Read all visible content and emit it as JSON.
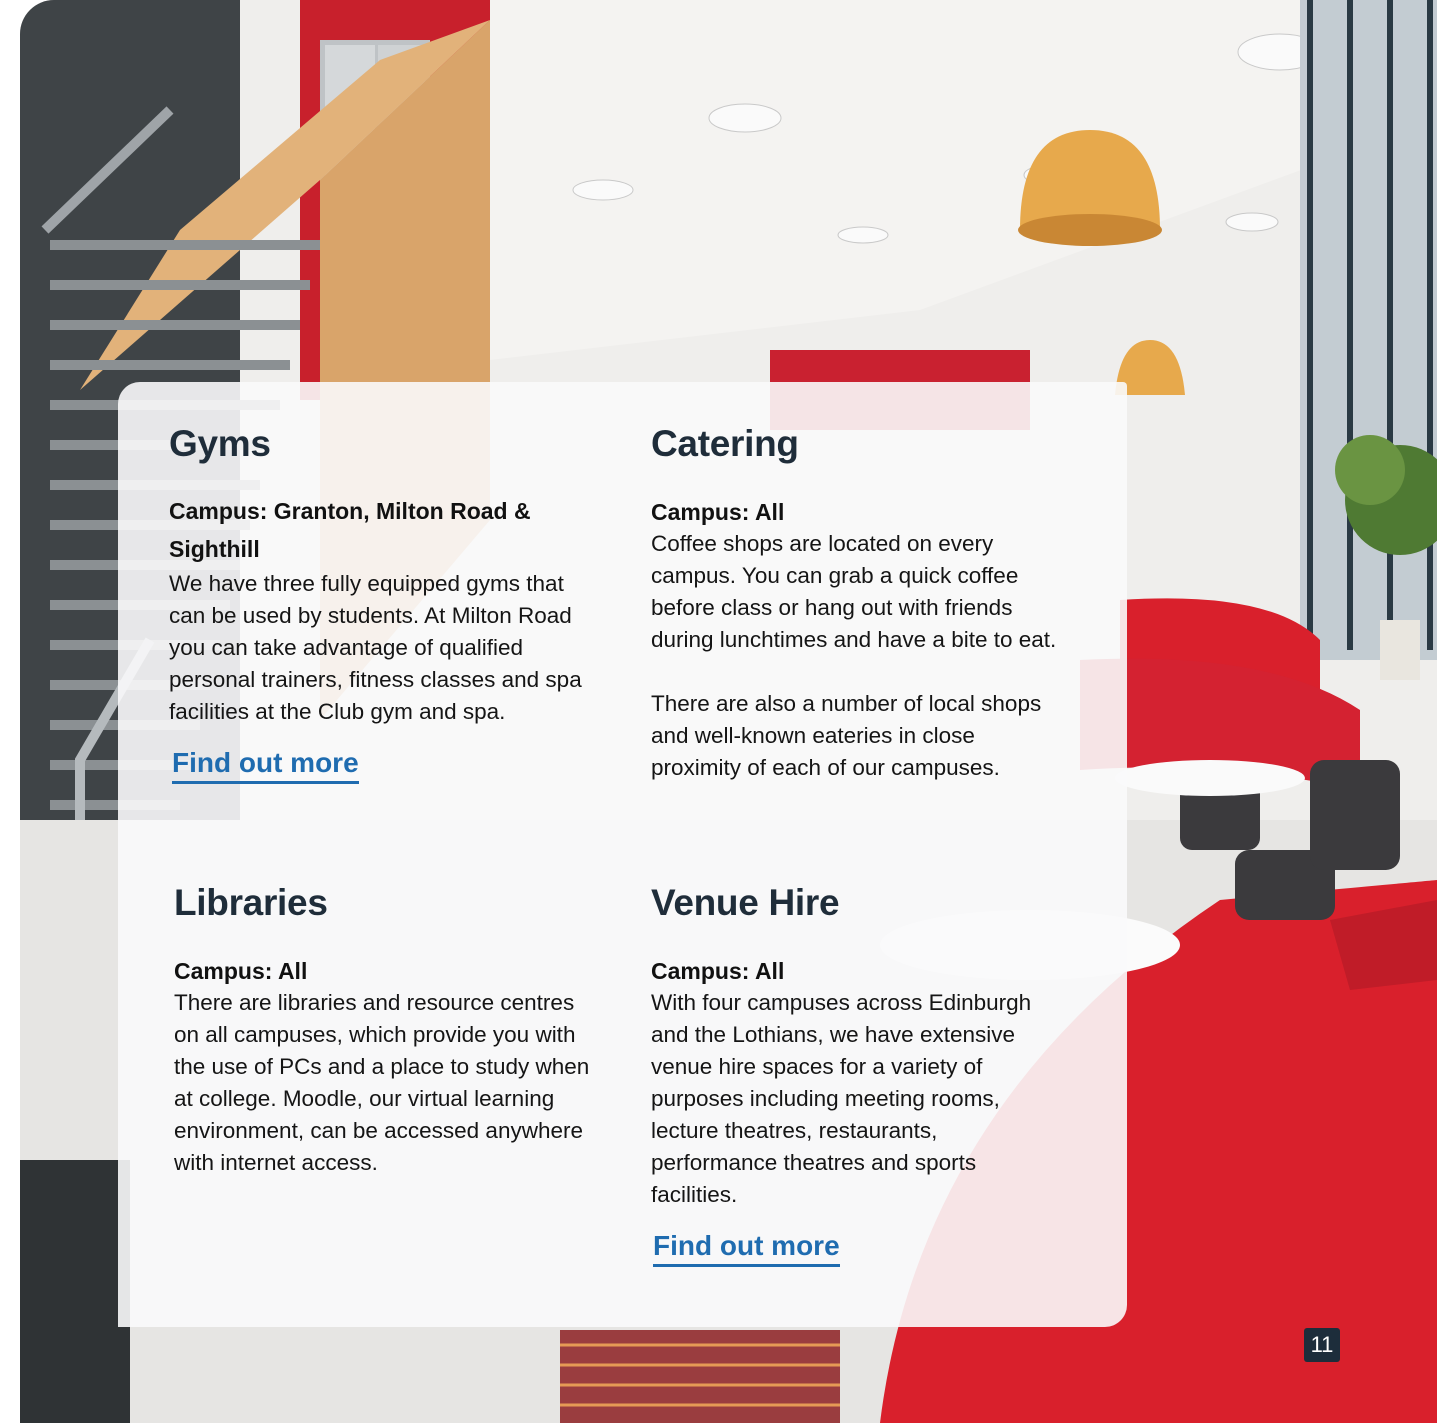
{
  "sections": {
    "gyms": {
      "title": "Gyms",
      "campus": "Campus: Granton, Milton Road & Sighthill",
      "body": "We have three fully equipped gyms that can be used by students. At Milton Road you can take advantage of qualified personal trainers, fitness classes and spa facilities at the Club gym and spa.",
      "link": "Find out more"
    },
    "catering": {
      "title": "Catering",
      "campus": "Campus: All",
      "body1": "Coffee shops are located on every campus. You can grab a quick coffee before class or hang out with friends during lunchtimes and have a bite to eat.",
      "body2": "There are also a number of local shops and well-known eateries in close proximity of each of our campuses."
    },
    "libraries": {
      "title": "Libraries",
      "campus": "Campus: All",
      "body": "There are libraries and resource centres on all campuses, which provide you with the use of PCs and a place to study when at college. Moodle, our virtual learning environment, can be accessed anywhere with internet access."
    },
    "venue": {
      "title": "Venue Hire",
      "campus": "Campus: All",
      "body": "With four campuses across Edinburgh and the Lothians, we have extensive venue hire spaces for a variety of purposes including meeting rooms, lecture theatres, restaurants, performance theatres and sports facilities.",
      "link": "Find out more"
    }
  },
  "page_number": "11",
  "colors": {
    "heading": "#1f2d3a",
    "link": "#1f6cb0",
    "seating_red": "#d9202c",
    "page_badge": "#1d2d3b"
  }
}
